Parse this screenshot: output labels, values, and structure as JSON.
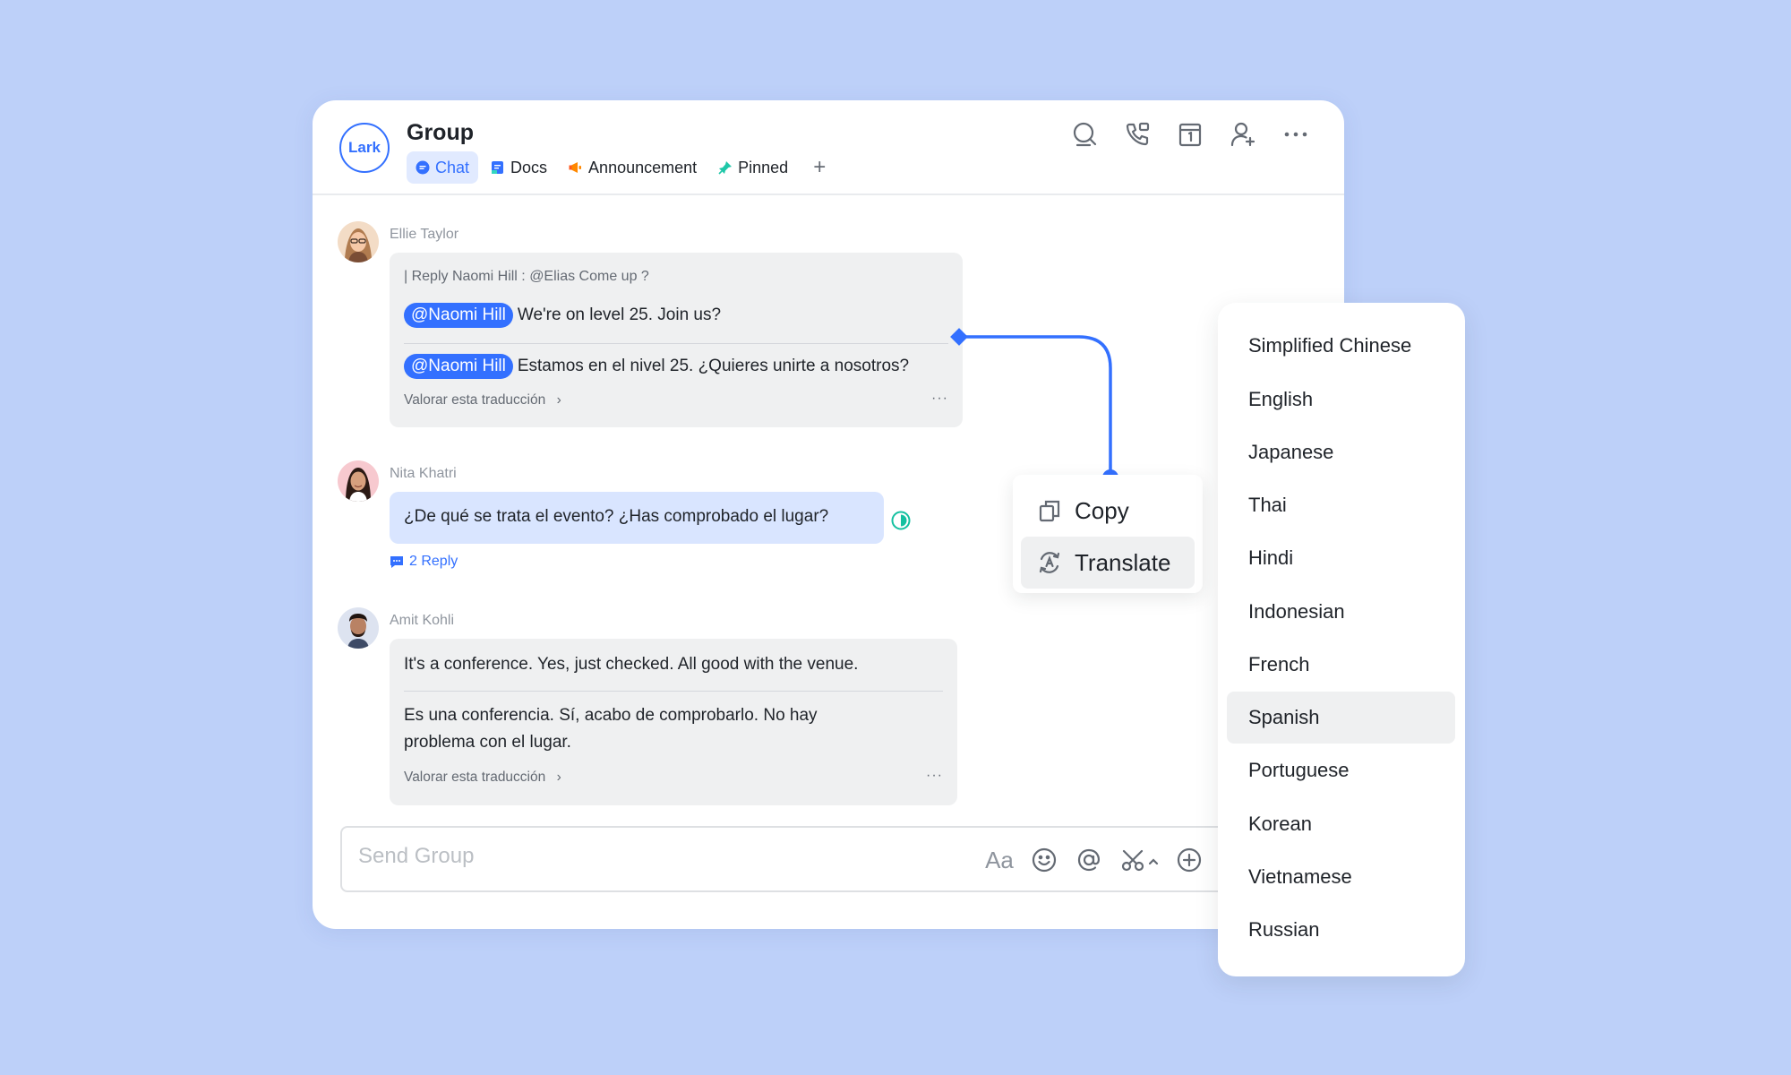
{
  "header": {
    "logo_text": "Lark",
    "title": "Group",
    "tabs": [
      {
        "label": "Chat",
        "icon": "chat-bubble-icon",
        "active": true
      },
      {
        "label": "Docs",
        "icon": "docs-icon",
        "active": false
      },
      {
        "label": "Announcement",
        "icon": "megaphone-icon",
        "active": false
      },
      {
        "label": "Pinned",
        "icon": "pin-icon",
        "active": false
      }
    ],
    "add_tab_label": "+",
    "actions": [
      "search-icon",
      "phone-call-icon",
      "calendar-icon",
      "add-member-icon",
      "more-icon"
    ]
  },
  "messages": [
    {
      "sender": "Ellie Taylor",
      "reply_quote": "| Reply Naomi Hill : @Elias Come up ?",
      "mention": "@Naomi Hill",
      "text": "We're on level 25. Join us?",
      "translation_mention": "@Naomi Hill",
      "translation": "Estamos en el nivel 25. ¿Quieres unirte a nosotros?",
      "rate_label": "Valorar esta traducción",
      "more_label": "···"
    },
    {
      "sender": "Nita Khatri",
      "text": "¿De qué se trata el evento? ¿Has comprobado el lugar?",
      "reply_count": "2 Reply"
    },
    {
      "sender": "Amit Kohli",
      "text": "It's a conference. Yes, just checked. All good with the venue.",
      "translation_line1": "Es una conferencia. Sí, acabo de comprobarlo. No hay",
      "translation_line2": "problema con el lugar.",
      "rate_label": "Valorar esta traducción",
      "more_label": "···"
    }
  ],
  "composer": {
    "placeholder": "Send Group",
    "font_icon_label": "Aa",
    "icons": [
      "text-format-icon",
      "emoji-icon",
      "mention-icon",
      "scissors-icon",
      "add-circle-icon"
    ]
  },
  "context_menu": {
    "items": [
      {
        "label": "Copy",
        "icon": "copy-icon"
      },
      {
        "label": "Translate",
        "icon": "translate-icon",
        "hover": true
      }
    ]
  },
  "languages": {
    "items": [
      "Simplified Chinese",
      "English",
      "Japanese",
      "Thai",
      "Hindi",
      "Indonesian",
      "French",
      "Spanish",
      "Portuguese",
      "Korean",
      "Vietnamese",
      "Russian"
    ],
    "selected": "Spanish"
  },
  "colors": {
    "background": "#bdd0f9",
    "accent": "#3370ff",
    "bubble_gray": "#eff0f1",
    "bubble_blue": "#d9e5ff"
  }
}
